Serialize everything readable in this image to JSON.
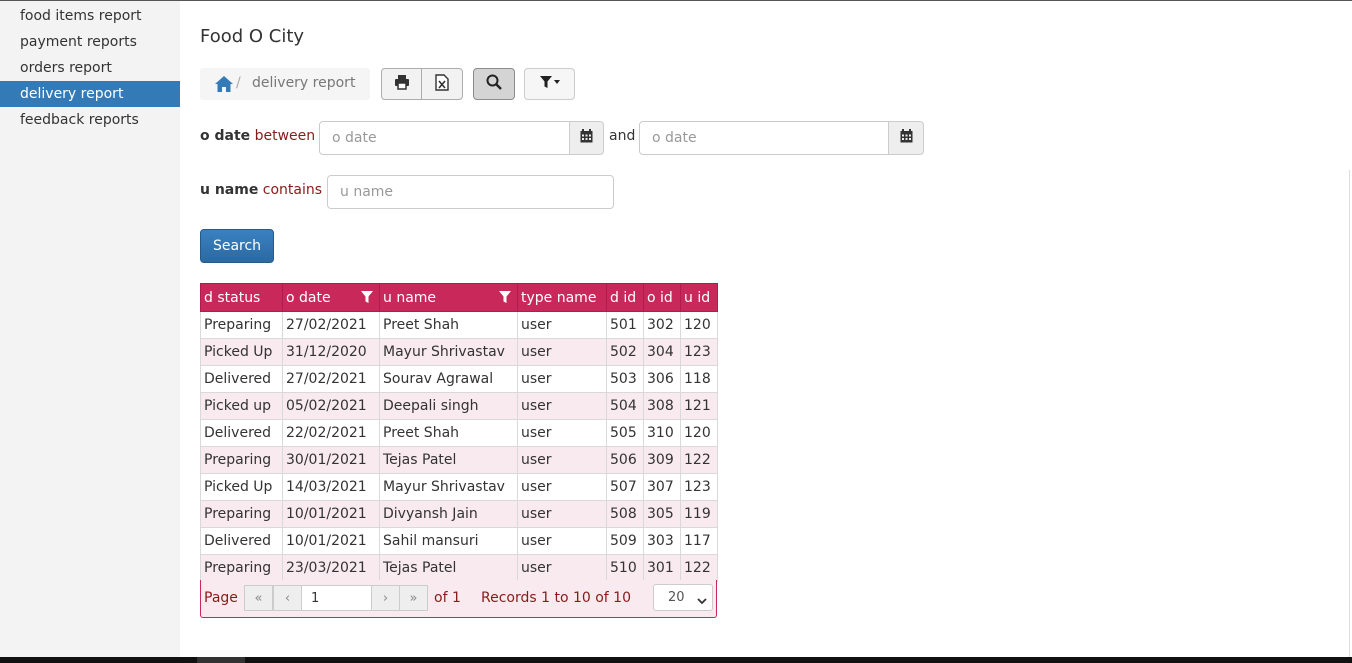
{
  "sidebar": {
    "items": [
      {
        "label": "food items report"
      },
      {
        "label": "payment reports"
      },
      {
        "label": "orders report"
      },
      {
        "label": "delivery report"
      },
      {
        "label": "feedback reports"
      }
    ],
    "active_index": 3
  },
  "header": {
    "app_title": "Food O City",
    "breadcrumb_separator": "/",
    "breadcrumb_current": "delivery report"
  },
  "filters": {
    "odate_field": "o date",
    "odate_operator": "between",
    "odate_from_placeholder": "o date",
    "odate_joiner": "and",
    "odate_to_placeholder": "o date",
    "uname_field": "u name",
    "uname_operator": "contains",
    "uname_placeholder": "u name",
    "search_label": "Search"
  },
  "table": {
    "columns": [
      "d status",
      "o date",
      "u name",
      "type name",
      "d id",
      "o id",
      "u id"
    ],
    "filtered_columns": [
      1,
      2
    ],
    "rows": [
      [
        "Preparing",
        "27/02/2021",
        "Preet Shah",
        "user",
        "501",
        "302",
        "120"
      ],
      [
        "Picked Up",
        "31/12/2020",
        "Mayur Shrivastav",
        "user",
        "502",
        "304",
        "123"
      ],
      [
        "Delivered",
        "27/02/2021",
        "Sourav Agrawal",
        "user",
        "503",
        "306",
        "118"
      ],
      [
        "Picked up",
        "05/02/2021",
        "Deepali singh",
        "user",
        "504",
        "308",
        "121"
      ],
      [
        "Delivered",
        "22/02/2021",
        "Preet Shah",
        "user",
        "505",
        "310",
        "120"
      ],
      [
        "Preparing",
        "30/01/2021",
        "Tejas Patel",
        "user",
        "506",
        "309",
        "122"
      ],
      [
        "Picked Up",
        "14/03/2021",
        "Mayur Shrivastav",
        "user",
        "507",
        "307",
        "123"
      ],
      [
        "Preparing",
        "10/01/2021",
        "Divyansh Jain",
        "user",
        "508",
        "305",
        "119"
      ],
      [
        "Delivered",
        "10/01/2021",
        "Sahil mansuri",
        "user",
        "509",
        "303",
        "117"
      ],
      [
        "Preparing",
        "23/03/2021",
        "Tejas Patel",
        "user",
        "510",
        "301",
        "122"
      ]
    ]
  },
  "pager": {
    "page_label": "Page",
    "page_value": "1",
    "of_text": "of 1",
    "records_text": "Records 1 to 10 of 10",
    "page_size": "20"
  },
  "colors": {
    "accent": "#337ab7",
    "grid_header": "#c9295a",
    "grid_alt_row": "#f8eaee",
    "operator_text": "#8a1a1a"
  },
  "icons": [
    "home-icon",
    "print-icon",
    "excel-icon",
    "search-icon",
    "filter-icon",
    "calendar-icon",
    "first-page-icon",
    "prev-page-icon",
    "next-page-icon",
    "last-page-icon",
    "chevron-down-icon"
  ]
}
